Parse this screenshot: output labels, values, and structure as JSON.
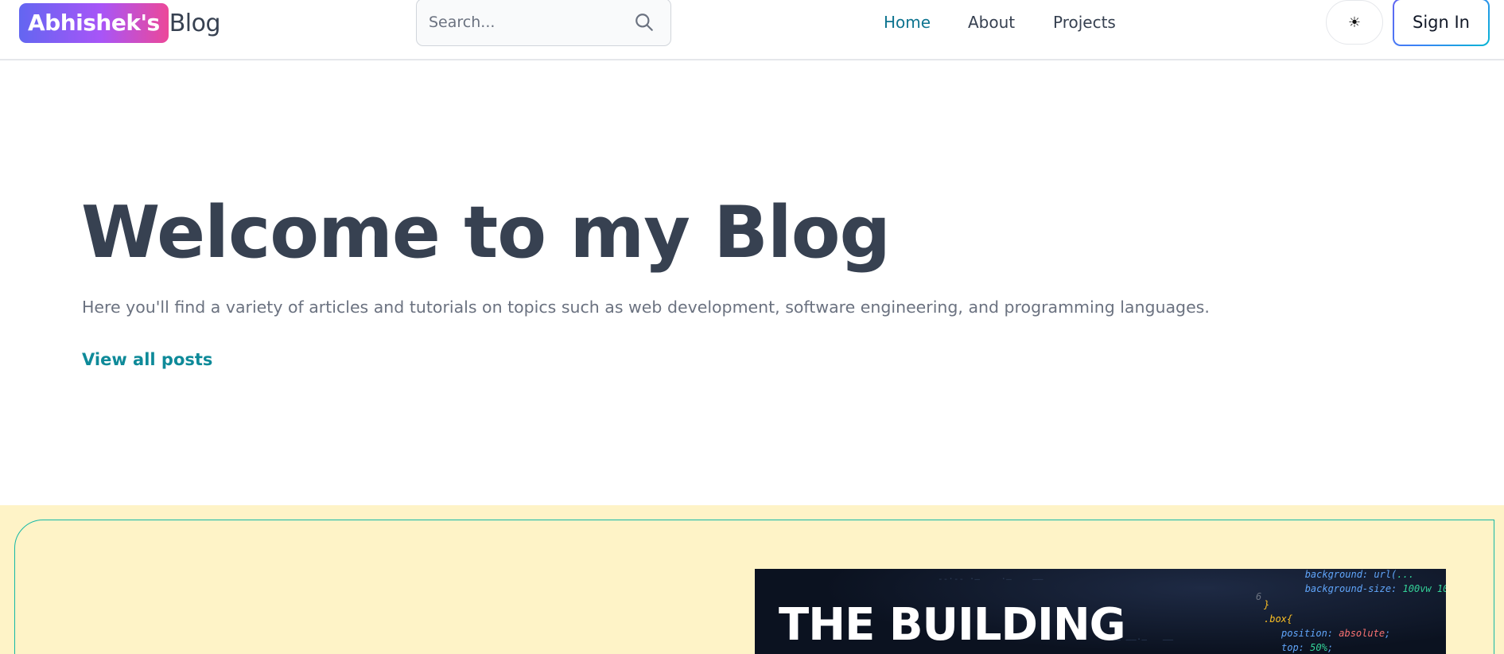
{
  "header": {
    "logo_badge": "Abhishek's",
    "logo_text": "Blog",
    "search_placeholder": "Search...",
    "nav": [
      {
        "label": "Home",
        "active": true
      },
      {
        "label": "About",
        "active": false
      },
      {
        "label": "Projects",
        "active": false
      }
    ],
    "theme_icon": "☀",
    "sign_in_label": "Sign In"
  },
  "hero": {
    "title": "Welcome to my Blog",
    "subtitle": "Here you'll find a variety of articles and tutorials on topics such as web development, software engineering, and programming languages.",
    "cta": "View all posts"
  },
  "featured": {
    "image_title": "THE BUILDING",
    "code_lines": [
      {
        "line": "",
        "text": "background: url("
      },
      {
        "line": "",
        "text": "background-size: 100vw 10"
      },
      {
        "line": "6",
        "text": ""
      },
      {
        "line": "",
        "text": "}"
      },
      {
        "line": "",
        "text": ".box{"
      },
      {
        "line": "",
        "text": "position: absolute;"
      },
      {
        "line": "",
        "text": "top: 50%;"
      }
    ]
  },
  "colors": {
    "accent": "#0e7490",
    "link": "#0e8a99",
    "featured_bg": "#fef3c7",
    "featured_border": "#14b8a6"
  }
}
